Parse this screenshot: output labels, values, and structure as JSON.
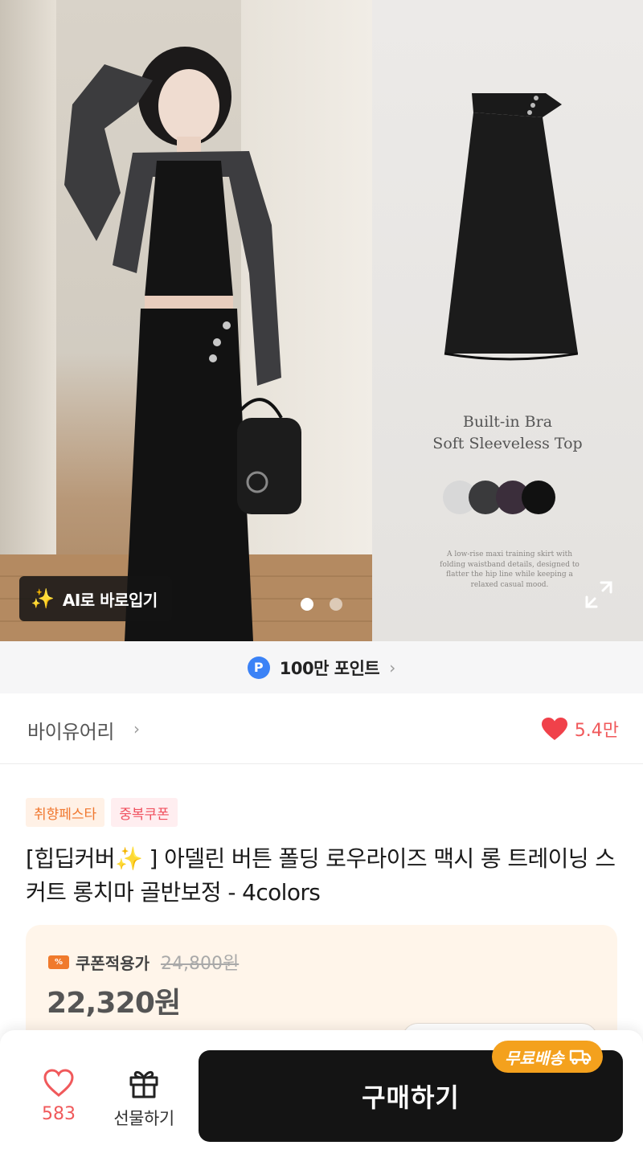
{
  "gallery": {
    "ai_button_label": "AI로 바로입기",
    "slide_count": 2,
    "active_slide": 1,
    "detail_tagline_line1": "Built-in Bra",
    "detail_tagline_line2": "Soft Sleeveless Top",
    "detail_small_text": "A low-rise maxi training skirt with folding waistband details, designed to flatter the hip line while keeping a relaxed casual mood.",
    "swatch_colors": [
      "#d8d8d8",
      "#3a3a3c",
      "#3b2e3b",
      "#111111"
    ]
  },
  "points": {
    "icon_letter": "P",
    "label": "100만 포인트"
  },
  "store": {
    "name": "바이유어리",
    "like_count": "5.4만"
  },
  "product": {
    "badges": [
      "취향페스타",
      "중복쿠폰"
    ],
    "title": "[힙딥커버✨ ] 아델린 버튼 폴딩 로우라이즈 맥시 롱 트레이닝 스커트 롱치마 골반보정 - 4colors"
  },
  "price": {
    "coupon_label": "쿠폰적용가",
    "original_price": "24,800원",
    "sale_price": "22,320원"
  },
  "bottom_bar": {
    "wish_count": "583",
    "gift_label": "선물하기",
    "buy_label": "구매하기",
    "free_shipping_label": "무료배송"
  },
  "colors": {
    "accent_red": "#f0595b",
    "points_blue": "#3b82f6",
    "free_shipping_orange": "#f4a11d",
    "buy_button_bg": "#141414"
  }
}
